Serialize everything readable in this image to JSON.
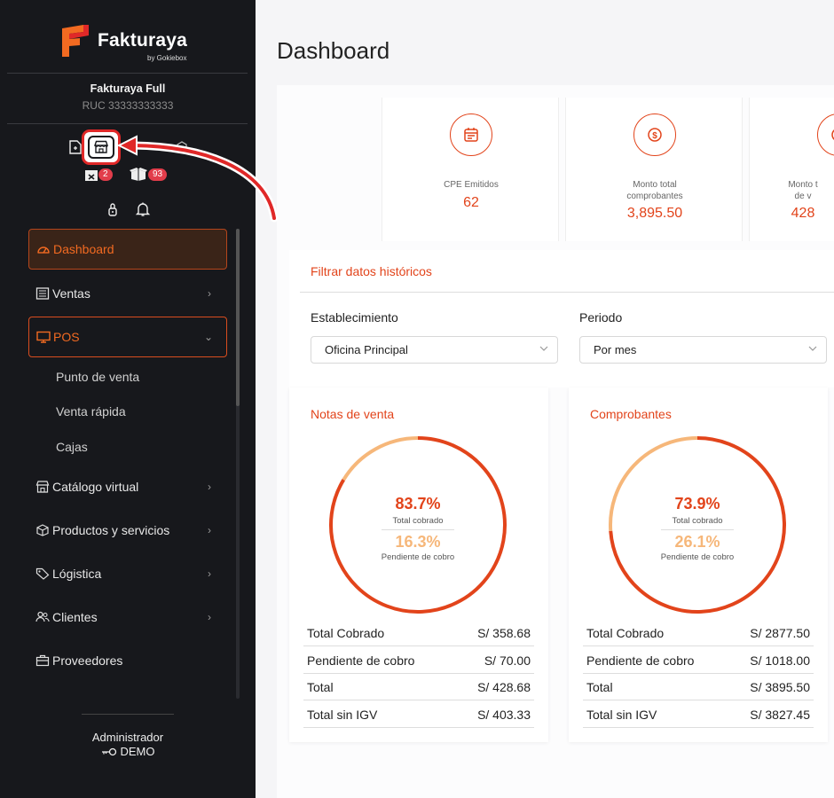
{
  "brand": {
    "name_main": "Fakturaya",
    "by": "by Gokiebox"
  },
  "company": {
    "name": "Fakturaya Full",
    "ruc": "RUC 33333333333"
  },
  "badges": {
    "orders": "2",
    "inventory": "93"
  },
  "menu": {
    "dashboard": "Dashboard",
    "ventas": "Ventas",
    "pos": "POS",
    "pos_sub": [
      "Punto de venta",
      "Venta rápida",
      "Cajas"
    ],
    "catalogo": "Catálogo virtual",
    "productos": "Productos y servicios",
    "logistica": "Lógistica",
    "clientes": "Clientes",
    "proveedores": "Proveedores"
  },
  "user": {
    "role": "Administrador",
    "name": "DEMO"
  },
  "page": {
    "title": "Dashboard"
  },
  "stats": [
    {
      "label": "CPE Emitidos",
      "value": "62"
    },
    {
      "label_line1": "Monto total",
      "label_line2": "comprobantes",
      "value": "3,895.50"
    },
    {
      "label_line1": "Monto t",
      "label_line2": "de v",
      "value": "428"
    }
  ],
  "filter": {
    "title": "Filtrar datos históricos",
    "establecimiento_label": "Establecimiento",
    "establecimiento_value": "Oficina Principal",
    "periodo_label": "Periodo",
    "periodo_value": "Por mes"
  },
  "chart_data": [
    {
      "type": "pie",
      "title": "Notas de venta",
      "categories": [
        "Total cobrado",
        "Pendiente de cobro"
      ],
      "values": [
        83.7,
        16.3
      ],
      "labels": [
        "83.7%",
        "16.3%"
      ],
      "colors": [
        "#e2441b",
        "#f6b77a"
      ]
    },
    {
      "type": "pie",
      "title": "Comprobantes",
      "categories": [
        "Total cobrado",
        "Pendiente de cobro"
      ],
      "values": [
        73.9,
        26.1
      ],
      "labels": [
        "73.9%",
        "26.1%"
      ],
      "colors": [
        "#e2441b",
        "#f6b77a"
      ]
    }
  ],
  "notas_table": [
    {
      "label": "Total Cobrado",
      "value": "S/ 358.68"
    },
    {
      "label": "Pendiente de cobro",
      "value": "S/ 70.00"
    },
    {
      "label": "Total",
      "value": "S/ 428.68"
    },
    {
      "label": "Total sin IGV",
      "value": "S/ 403.33"
    }
  ],
  "comprobantes_table": [
    {
      "label": "Total Cobrado",
      "value": "S/ 2877.50"
    },
    {
      "label": "Pendiente de cobro",
      "value": "S/ 1018.00"
    },
    {
      "label": "Total",
      "value": "S/ 3895.50"
    },
    {
      "label": "Total sin IGV",
      "value": "S/ 3827.45"
    }
  ],
  "colors": {
    "accent": "#e2441b",
    "accent_light": "#f6b77a",
    "sidebar_bg": "#17181c",
    "highlight": "#e02828"
  }
}
